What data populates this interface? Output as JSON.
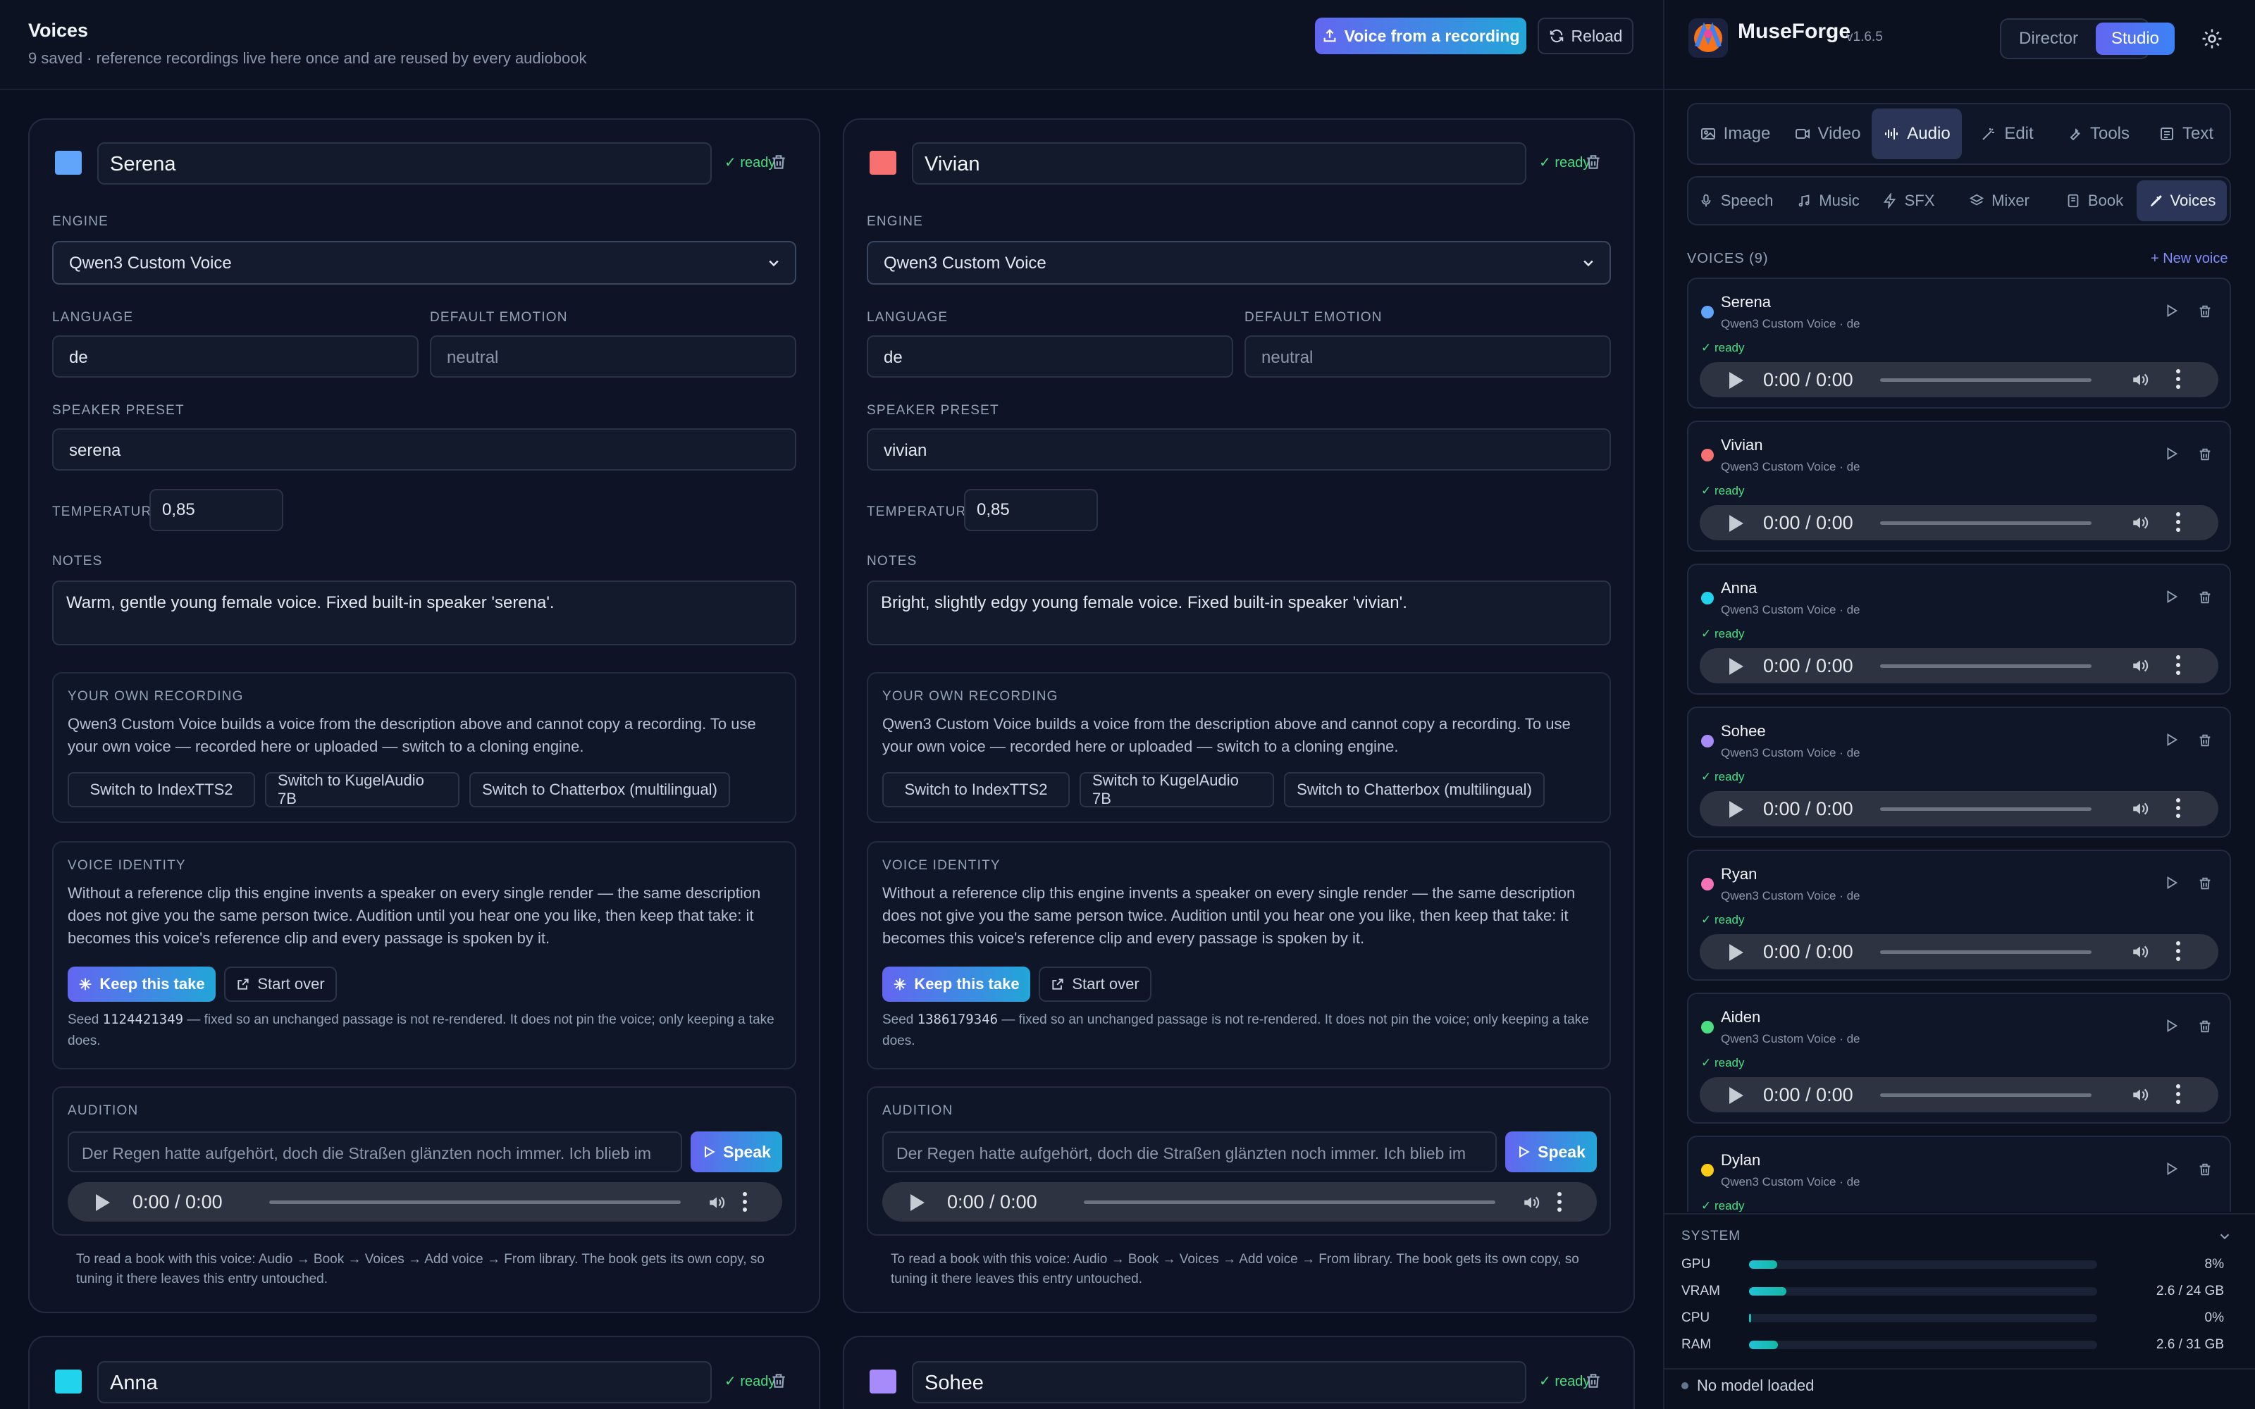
{
  "header": {
    "title": "Voices",
    "subtitle": "9 saved · reference recordings live here once and are reused by every audiobook",
    "voice_from_recording": "Voice from a recording",
    "reload": "Reload"
  },
  "labels": {
    "engine": "ENGINE",
    "language": "LANGUAGE",
    "default_emotion": "DEFAULT EMOTION",
    "speaker_preset": "SPEAKER PRESET",
    "temperature": "TEMPERATURE",
    "notes": "NOTES",
    "own_recording": "YOUR OWN RECORDING",
    "own_recording_text": "Qwen3 Custom Voice builds a voice from the description above and cannot copy a recording. To use your own voice — recorded here or uploaded — switch to a cloning engine.",
    "switch_indextts": "Switch to IndexTTS2",
    "switch_kugel": "Switch to KugelAudio 7B",
    "switch_chatterbox": "Switch to Chatterbox (multilingual)",
    "voice_identity": "VOICE IDENTITY",
    "voice_identity_text": "Without a reference clip this engine invents a speaker on every single render — the same description does not give you the same person twice. Audition until you hear one you like, then keep that take: it becomes this voice's reference clip and every passage is spoken by it.",
    "keep_take": "Keep this take",
    "start_over": "Start over",
    "seed_prefix": "Seed",
    "seed_suffix": "— fixed so an unchanged passage is not re-rendered. It does not pin the voice; only keeping a take does.",
    "audition": "AUDITION",
    "speak": "Speak",
    "footer_note": "To read a book with this voice: Audio → Book → Voices → Add voice → From library. The book gets its own copy, so tuning it there leaves this entry untouched.",
    "ready": "ready",
    "time": "0:00 / 0:00"
  },
  "cards": [
    {
      "name": "Serena",
      "color": "#60a5fa",
      "engine": "Qwen3 Custom Voice",
      "language": "de",
      "emotion_placeholder": "neutral",
      "preset": "serena",
      "temperature": "0,85",
      "notes": "Warm, gentle young female voice. Fixed built-in speaker 'serena'.",
      "seed": "1124421349",
      "audition_text": "Der Regen hatte aufgehört, doch die Straßen glänzten noch immer. Ich blieb im"
    },
    {
      "name": "Vivian",
      "color": "#f87171",
      "engine": "Qwen3 Custom Voice",
      "language": "de",
      "emotion_placeholder": "neutral",
      "preset": "vivian",
      "temperature": "0,85",
      "notes": "Bright, slightly edgy young female voice. Fixed built-in speaker 'vivian'.",
      "seed": "1386179346",
      "audition_text": "Der Regen hatte aufgehört, doch die Straßen glänzten noch immer. Ich blieb im"
    },
    {
      "name": "Anna",
      "color": "#22d3ee"
    },
    {
      "name": "Sohee",
      "color": "#a78bfa"
    }
  ],
  "sidebar": {
    "brand": "MuseForge",
    "version": "v1.6.5",
    "mode_director": "Director",
    "mode_studio": "Studio",
    "tabs": [
      "Image",
      "Video",
      "Audio",
      "Edit",
      "Tools",
      "Text"
    ],
    "subtabs": [
      "Speech",
      "Music",
      "SFX",
      "Mixer",
      "Book",
      "Voices"
    ],
    "voices_heading": "VOICES (9)",
    "new_voice": "+ New voice",
    "voices": [
      {
        "name": "Serena",
        "meta": "Qwen3 Custom Voice · de",
        "status": "✓ ready",
        "color": "#60a5fa"
      },
      {
        "name": "Vivian",
        "meta": "Qwen3 Custom Voice · de",
        "status": "✓ ready",
        "color": "#f87171"
      },
      {
        "name": "Anna",
        "meta": "Qwen3 Custom Voice · de",
        "status": "✓ ready",
        "color": "#22d3ee"
      },
      {
        "name": "Sohee",
        "meta": "Qwen3 Custom Voice · de",
        "status": "✓ ready",
        "color": "#a78bfa"
      },
      {
        "name": "Ryan",
        "meta": "Qwen3 Custom Voice · de",
        "status": "✓ ready",
        "color": "#f472b6"
      },
      {
        "name": "Aiden",
        "meta": "Qwen3 Custom Voice · de",
        "status": "✓ ready",
        "color": "#4ade80"
      },
      {
        "name": "Dylan",
        "meta": "Qwen3 Custom Voice · de",
        "status": "✓ ready",
        "color": "#facc15"
      }
    ],
    "system": {
      "heading": "SYSTEM",
      "rows": [
        {
          "label": "GPU",
          "value": "8%",
          "fraction": 0.08
        },
        {
          "label": "VRAM",
          "value": "2.6 / 24 GB",
          "fraction": 0.108
        },
        {
          "label": "CPU",
          "value": "0%",
          "fraction": 0.0
        },
        {
          "label": "RAM",
          "value": "2.6 / 31 GB",
          "fraction": 0.084
        }
      ],
      "status": "No model loaded"
    }
  }
}
